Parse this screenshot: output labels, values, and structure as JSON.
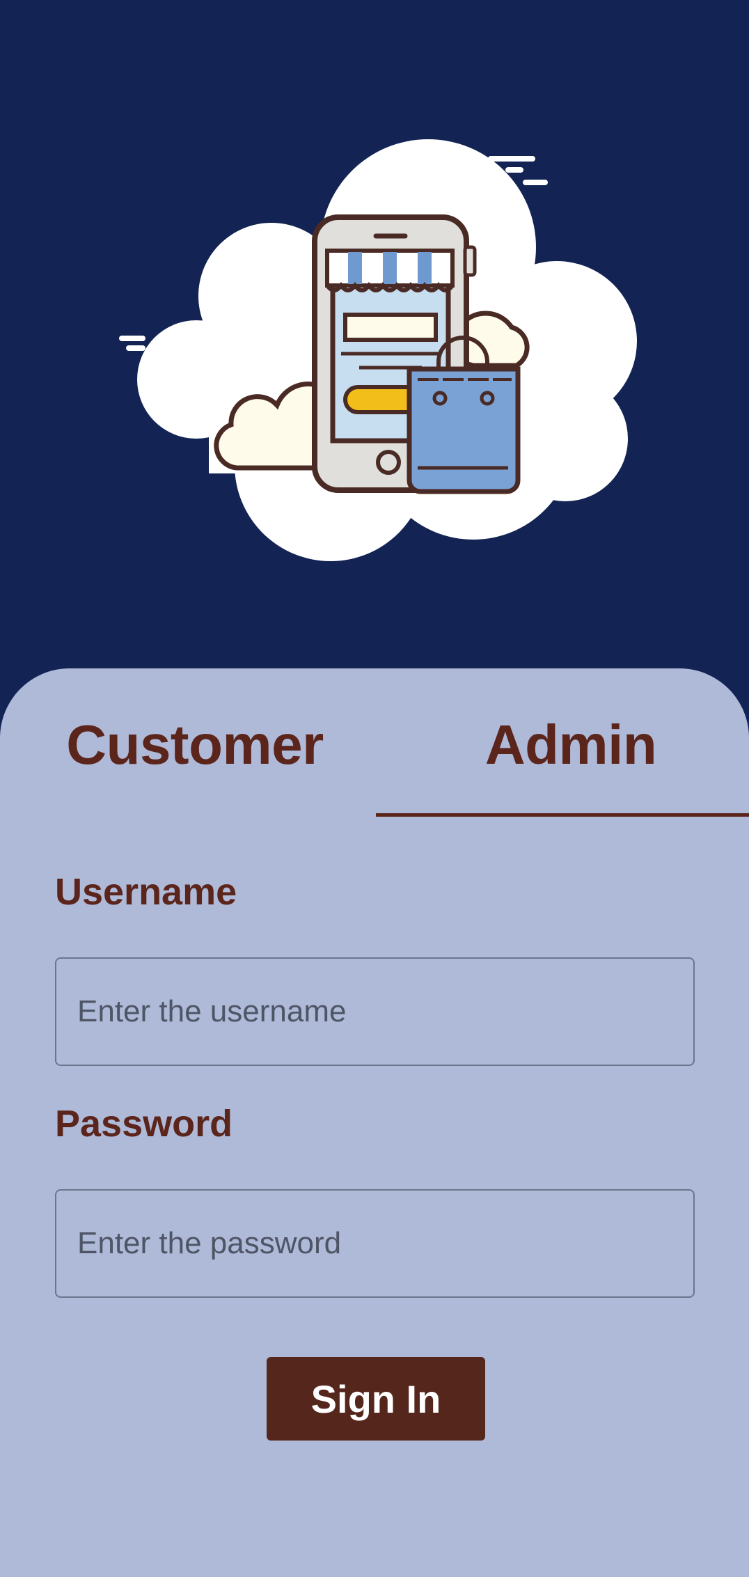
{
  "colors": {
    "background": "#122354",
    "sheet": "#AFBAD8",
    "brand_brown": "#5B251C",
    "button": "#55271C",
    "button_text": "#FFFFFF",
    "cloud": "#FFFFFF",
    "phone_screen": "#C7DDF0",
    "bag": "#7AA2D4",
    "accent_yellow": "#F2BE1A"
  },
  "hero": {
    "illustration": "cloud-shopping-phone-illustration",
    "icons": [
      "cloud-icon",
      "smartphone-store-icon",
      "shopping-bag-icon"
    ]
  },
  "tabs": [
    {
      "label": "Customer",
      "selected": false
    },
    {
      "label": "Admin",
      "selected": true
    }
  ],
  "form": {
    "username_label": "Username",
    "username_placeholder": "Enter the username",
    "username_value": "",
    "password_label": "Password",
    "password_placeholder": "Enter the password",
    "password_value": ""
  },
  "actions": {
    "signin_label": "Sign In"
  }
}
